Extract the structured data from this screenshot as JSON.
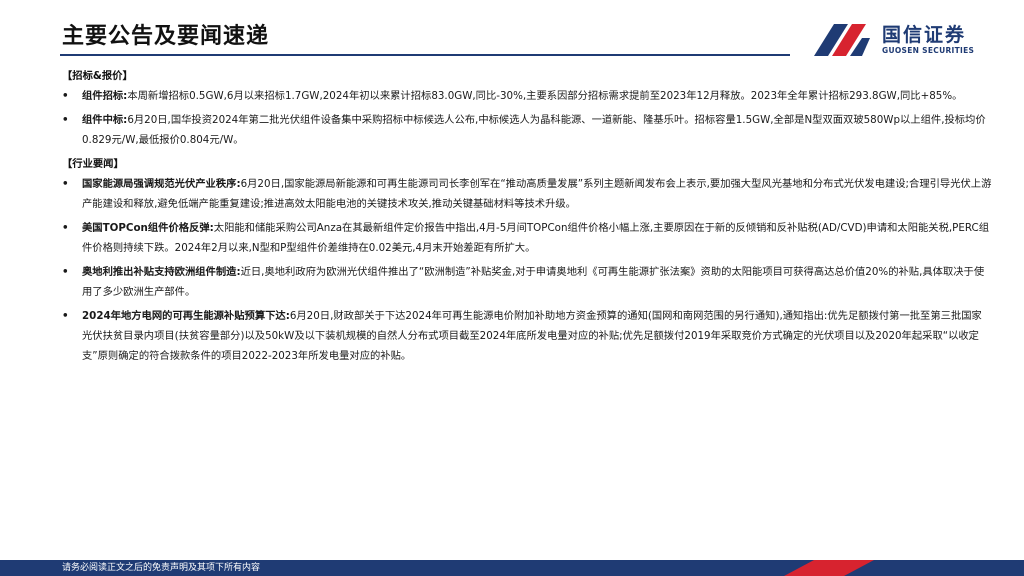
{
  "header": {
    "title": "主要公告及要闻速递",
    "logo_cn": "国信证券",
    "logo_en": "GUOSEN SECURITIES",
    "brand_color": "#1f3b74",
    "accent_color": "#d7232f"
  },
  "sections": [
    {
      "heading": "【招标&报价】",
      "items": [
        {
          "title": "组件招标:",
          "body": "本周新增招标0.5GW,6月以来招标1.7GW,2024年初以来累计招标83.0GW,同比-30%,主要系因部分招标需求提前至2023年12月释放。2023年全年累计招标293.8GW,同比+85%。"
        },
        {
          "title": "组件中标:",
          "body": "6月20日,国华投资2024年第二批光伏组件设备集中采购招标中标候选人公布,中标候选人为晶科能源、一道新能、隆基乐叶。招标容量1.5GW,全部是N型双面双玻580Wp以上组件,投标均价0.829元/W,最低报价0.804元/W。"
        }
      ]
    },
    {
      "heading": "【行业要闻】",
      "items": [
        {
          "title": "国家能源局强调规范光伏产业秩序:",
          "body": "6月20日,国家能源局新能源和可再生能源司司长李创军在“推动高质量发展”系列主题新闻发布会上表示,要加强大型风光基地和分布式光伏发电建设;合理引导光伏上游产能建设和释放,避免低端产能重复建设;推进高效太阳能电池的关键技术攻关,推动关键基础材料等技术升级。"
        },
        {
          "title": "美国TOPCon组件价格反弹:",
          "body": "太阳能和储能采购公司Anza在其最新组件定价报告中指出,4月-5月间TOPCon组件价格小幅上涨,主要原因在于新的反倾销和反补贴税(AD/CVD)申请和太阳能关税,PERC组件价格则持续下跌。2024年2月以来,N型和P型组件价差维持在0.02美元,4月末开始差距有所扩大。"
        },
        {
          "title": "奥地利推出补贴支持欧洲组件制造:",
          "body": "近日,奥地利政府为欧洲光伏组件推出了“欧洲制造”补贴奖金,对于申请奥地利《可再生能源扩张法案》资助的太阳能项目可获得高达总价值20%的补贴,具体取决于使用了多少欧洲生产部件。"
        },
        {
          "title": "2024年地方电网的可再生能源补贴预算下达:",
          "body": "6月20日,财政部关于下达2024年可再生能源电价附加补助地方资金预算的通知(国网和南网范围的另行通知),通知指出:优先足额拨付第一批至第三批国家光伏扶贫目录内项目(扶贫容量部分)以及50kW及以下装机规模的自然人分布式项目截至2024年底所发电量对应的补贴;优先足额拨付2019年采取竞价方式确定的光伏项目以及2020年起采取“以收定支”原则确定的符合拨款条件的项目2022-2023年所发电量对应的补贴。"
        }
      ]
    }
  ],
  "bullet": "•",
  "footer": {
    "disclaimer": "请务必阅读正文之后的免责声明及其项下所有内容"
  }
}
